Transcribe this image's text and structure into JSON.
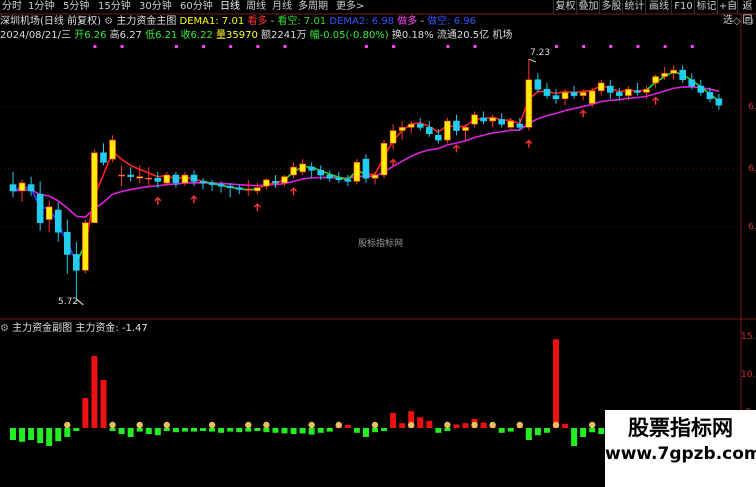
{
  "toolbar": {
    "periods": [
      "分时",
      "1分钟",
      "5分钟",
      "15分钟",
      "30分钟",
      "60分钟",
      "日线",
      "周线",
      "月线",
      "多周期",
      "更多>"
    ],
    "buttons": [
      "复权",
      "叠加",
      "多股",
      "统计",
      "画线",
      "F10",
      "标记",
      "+自选",
      "返回"
    ]
  },
  "header": {
    "stock": "深圳机场(日线 前复权)",
    "indicator": "主力资金主图",
    "dema1": "DEMA1: 7.01",
    "kanduo": "看多",
    "kankong": "看空: 7.01",
    "dema2": "DEMA2: 6.98",
    "zuoduo": "做多",
    "zuokong": "做空: 6.96"
  },
  "quote": {
    "date": "2024/08/21/三",
    "open": "开6.26",
    "high": "高6.27",
    "low": "低6.21",
    "close": "收6.22",
    "volume": "量35970",
    "amount": "额2241万",
    "change": "幅-0.05(-0.80%)",
    "turnover": "换0.18%",
    "float": "流通20.5亿",
    "industry": "机场"
  },
  "price_axis": [
    "6.",
    "6.",
    "6."
  ],
  "price_labels": {
    "high": "7.23",
    "low": "5.72"
  },
  "sub": {
    "title": "主力资金副图",
    "value": "主力资金: -1.47",
    "axis": [
      "15.",
      "10.",
      "5."
    ]
  },
  "watermark": {
    "center": "股标指标网",
    "title": "股票指标网",
    "url": "www.7gpzb.com"
  },
  "chart_data": {
    "type": "candlestick",
    "ylim": [
      5.6,
      7.35
    ],
    "candles": [
      {
        "o": 6.44,
        "h": 6.52,
        "l": 6.36,
        "c": 6.4
      },
      {
        "o": 6.4,
        "h": 6.47,
        "l": 6.33,
        "c": 6.45
      },
      {
        "o": 6.44,
        "h": 6.49,
        "l": 6.37,
        "c": 6.4
      },
      {
        "o": 6.38,
        "h": 6.46,
        "l": 6.15,
        "c": 6.2
      },
      {
        "o": 6.22,
        "h": 6.34,
        "l": 6.14,
        "c": 6.3
      },
      {
        "o": 6.28,
        "h": 6.33,
        "l": 6.08,
        "c": 6.14
      },
      {
        "o": 6.14,
        "h": 6.22,
        "l": 5.88,
        "c": 6.0
      },
      {
        "o": 6.0,
        "h": 6.08,
        "l": 5.72,
        "c": 5.9
      },
      {
        "o": 5.9,
        "h": 6.22,
        "l": 5.88,
        "c": 6.2
      },
      {
        "o": 6.2,
        "h": 6.66,
        "l": 6.2,
        "c": 6.64
      },
      {
        "o": 6.64,
        "h": 6.7,
        "l": 6.56,
        "c": 6.58
      },
      {
        "o": 6.6,
        "h": 6.75,
        "l": 6.58,
        "c": 6.72
      },
      {
        "o": 6.5,
        "h": 6.56,
        "l": 6.43,
        "c": 6.5
      },
      {
        "o": 6.5,
        "h": 6.55,
        "l": 6.46,
        "c": 6.49
      },
      {
        "o": 6.48,
        "h": 6.56,
        "l": 6.45,
        "c": 6.49
      },
      {
        "o": 6.48,
        "h": 6.55,
        "l": 6.43,
        "c": 6.48
      },
      {
        "o": 6.48,
        "h": 6.52,
        "l": 6.42,
        "c": 6.46
      },
      {
        "o": 6.45,
        "h": 6.52,
        "l": 6.43,
        "c": 6.5
      },
      {
        "o": 6.5,
        "h": 6.52,
        "l": 6.42,
        "c": 6.45
      },
      {
        "o": 6.45,
        "h": 6.52,
        "l": 6.43,
        "c": 6.5
      },
      {
        "o": 6.5,
        "h": 6.53,
        "l": 6.43,
        "c": 6.46
      },
      {
        "o": 6.46,
        "h": 6.48,
        "l": 6.41,
        "c": 6.45
      },
      {
        "o": 6.45,
        "h": 6.47,
        "l": 6.4,
        "c": 6.44
      },
      {
        "o": 6.44,
        "h": 6.46,
        "l": 6.39,
        "c": 6.43
      },
      {
        "o": 6.43,
        "h": 6.45,
        "l": 6.36,
        "c": 6.42
      },
      {
        "o": 6.42,
        "h": 6.44,
        "l": 6.38,
        "c": 6.41
      },
      {
        "o": 6.41,
        "h": 6.47,
        "l": 6.37,
        "c": 6.41
      },
      {
        "o": 6.4,
        "h": 6.45,
        "l": 6.38,
        "c": 6.42
      },
      {
        "o": 6.43,
        "h": 6.48,
        "l": 6.41,
        "c": 6.47
      },
      {
        "o": 6.46,
        "h": 6.5,
        "l": 6.42,
        "c": 6.45
      },
      {
        "o": 6.45,
        "h": 6.5,
        "l": 6.43,
        "c": 6.49
      },
      {
        "o": 6.5,
        "h": 6.58,
        "l": 6.48,
        "c": 6.55
      },
      {
        "o": 6.52,
        "h": 6.6,
        "l": 6.5,
        "c": 6.57
      },
      {
        "o": 6.55,
        "h": 6.58,
        "l": 6.48,
        "c": 6.53
      },
      {
        "o": 6.53,
        "h": 6.56,
        "l": 6.47,
        "c": 6.5
      },
      {
        "o": 6.5,
        "h": 6.53,
        "l": 6.46,
        "c": 6.48
      },
      {
        "o": 6.48,
        "h": 6.52,
        "l": 6.45,
        "c": 6.47
      },
      {
        "o": 6.47,
        "h": 6.5,
        "l": 6.43,
        "c": 6.46
      },
      {
        "o": 6.46,
        "h": 6.6,
        "l": 6.44,
        "c": 6.58
      },
      {
        "o": 6.6,
        "h": 6.63,
        "l": 6.45,
        "c": 6.48
      },
      {
        "o": 6.48,
        "h": 6.52,
        "l": 6.44,
        "c": 6.5
      },
      {
        "o": 6.5,
        "h": 6.72,
        "l": 6.48,
        "c": 6.7
      },
      {
        "o": 6.7,
        "h": 6.82,
        "l": 6.66,
        "c": 6.78
      },
      {
        "o": 6.78,
        "h": 6.84,
        "l": 6.72,
        "c": 6.8
      },
      {
        "o": 6.8,
        "h": 6.84,
        "l": 6.76,
        "c": 6.82
      },
      {
        "o": 6.82,
        "h": 6.86,
        "l": 6.78,
        "c": 6.8
      },
      {
        "o": 6.8,
        "h": 6.84,
        "l": 6.74,
        "c": 6.76
      },
      {
        "o": 6.75,
        "h": 6.79,
        "l": 6.7,
        "c": 6.72
      },
      {
        "o": 6.72,
        "h": 6.86,
        "l": 6.7,
        "c": 6.84
      },
      {
        "o": 6.84,
        "h": 6.88,
        "l": 6.75,
        "c": 6.78
      },
      {
        "o": 6.78,
        "h": 6.82,
        "l": 6.72,
        "c": 6.8
      },
      {
        "o": 6.82,
        "h": 6.9,
        "l": 6.8,
        "c": 6.88
      },
      {
        "o": 6.86,
        "h": 6.9,
        "l": 6.82,
        "c": 6.84
      },
      {
        "o": 6.84,
        "h": 6.88,
        "l": 6.8,
        "c": 6.86
      },
      {
        "o": 6.85,
        "h": 6.89,
        "l": 6.8,
        "c": 6.82
      },
      {
        "o": 6.8,
        "h": 6.86,
        "l": 6.78,
        "c": 6.84
      },
      {
        "o": 6.82,
        "h": 6.86,
        "l": 6.78,
        "c": 6.8
      },
      {
        "o": 6.8,
        "h": 7.23,
        "l": 6.78,
        "c": 7.1
      },
      {
        "o": 7.1,
        "h": 7.14,
        "l": 7.02,
        "c": 7.04
      },
      {
        "o": 7.04,
        "h": 7.08,
        "l": 6.98,
        "c": 7.0
      },
      {
        "o": 7.0,
        "h": 7.04,
        "l": 6.95,
        "c": 6.98
      },
      {
        "o": 6.98,
        "h": 7.04,
        "l": 6.94,
        "c": 7.02
      },
      {
        "o": 7.02,
        "h": 7.06,
        "l": 6.98,
        "c": 7.0
      },
      {
        "o": 7.0,
        "h": 7.04,
        "l": 6.97,
        "c": 7.02
      },
      {
        "o": 6.95,
        "h": 7.05,
        "l": 6.93,
        "c": 7.03
      },
      {
        "o": 7.03,
        "h": 7.1,
        "l": 7.0,
        "c": 7.08
      },
      {
        "o": 7.06,
        "h": 7.1,
        "l": 6.98,
        "c": 7.02
      },
      {
        "o": 7.02,
        "h": 7.05,
        "l": 6.97,
        "c": 7.0
      },
      {
        "o": 7.0,
        "h": 7.06,
        "l": 6.97,
        "c": 7.04
      },
      {
        "o": 7.03,
        "h": 7.08,
        "l": 7.0,
        "c": 7.02
      },
      {
        "o": 7.02,
        "h": 7.06,
        "l": 6.98,
        "c": 7.04
      },
      {
        "o": 7.08,
        "h": 7.13,
        "l": 7.05,
        "c": 7.12
      },
      {
        "o": 7.12,
        "h": 7.18,
        "l": 7.1,
        "c": 7.14
      },
      {
        "o": 7.14,
        "h": 7.19,
        "l": 7.1,
        "c": 7.16
      },
      {
        "o": 7.16,
        "h": 7.19,
        "l": 7.08,
        "c": 7.1
      },
      {
        "o": 7.1,
        "h": 7.14,
        "l": 7.04,
        "c": 7.06
      },
      {
        "o": 7.06,
        "h": 7.1,
        "l": 7.0,
        "c": 7.02
      },
      {
        "o": 7.02,
        "h": 7.05,
        "l": 6.96,
        "c": 6.98
      },
      {
        "o": 6.98,
        "h": 7.01,
        "l": 6.91,
        "c": 6.94
      }
    ],
    "flow": [
      -2,
      -2.3,
      -2,
      -2.5,
      -3,
      -2.2,
      -1.5,
      -0.5,
      5,
      12,
      8,
      -0.5,
      -1,
      -1.5,
      -0.6,
      -1,
      -1.2,
      -0.5,
      -0.7,
      -0.6,
      -0.6,
      -0.5,
      -0.6,
      -0.8,
      -0.6,
      -0.7,
      -0.6,
      -0.5,
      -0.7,
      -0.8,
      -0.9,
      -1,
      -0.9,
      -1.1,
      -0.8,
      -0.6,
      0.6,
      0.5,
      -0.8,
      -1.5,
      -0.7,
      -0.5,
      2.5,
      0.8,
      2.8,
      1.8,
      1.2,
      -0.8,
      -0.5,
      0.6,
      0.8,
      1.5,
      0.9,
      0.4,
      -0.8,
      -0.6,
      0.7,
      -2,
      -1.2,
      -0.8,
      14.8,
      0.7,
      -3,
      -1.5,
      -0.7,
      -1,
      -0.4,
      -0.7,
      -1.5,
      0.8,
      0.5,
      -0.7,
      -0.8,
      -1.2,
      -1,
      -0.8,
      -0.6,
      1.5,
      -0.7
    ]
  }
}
